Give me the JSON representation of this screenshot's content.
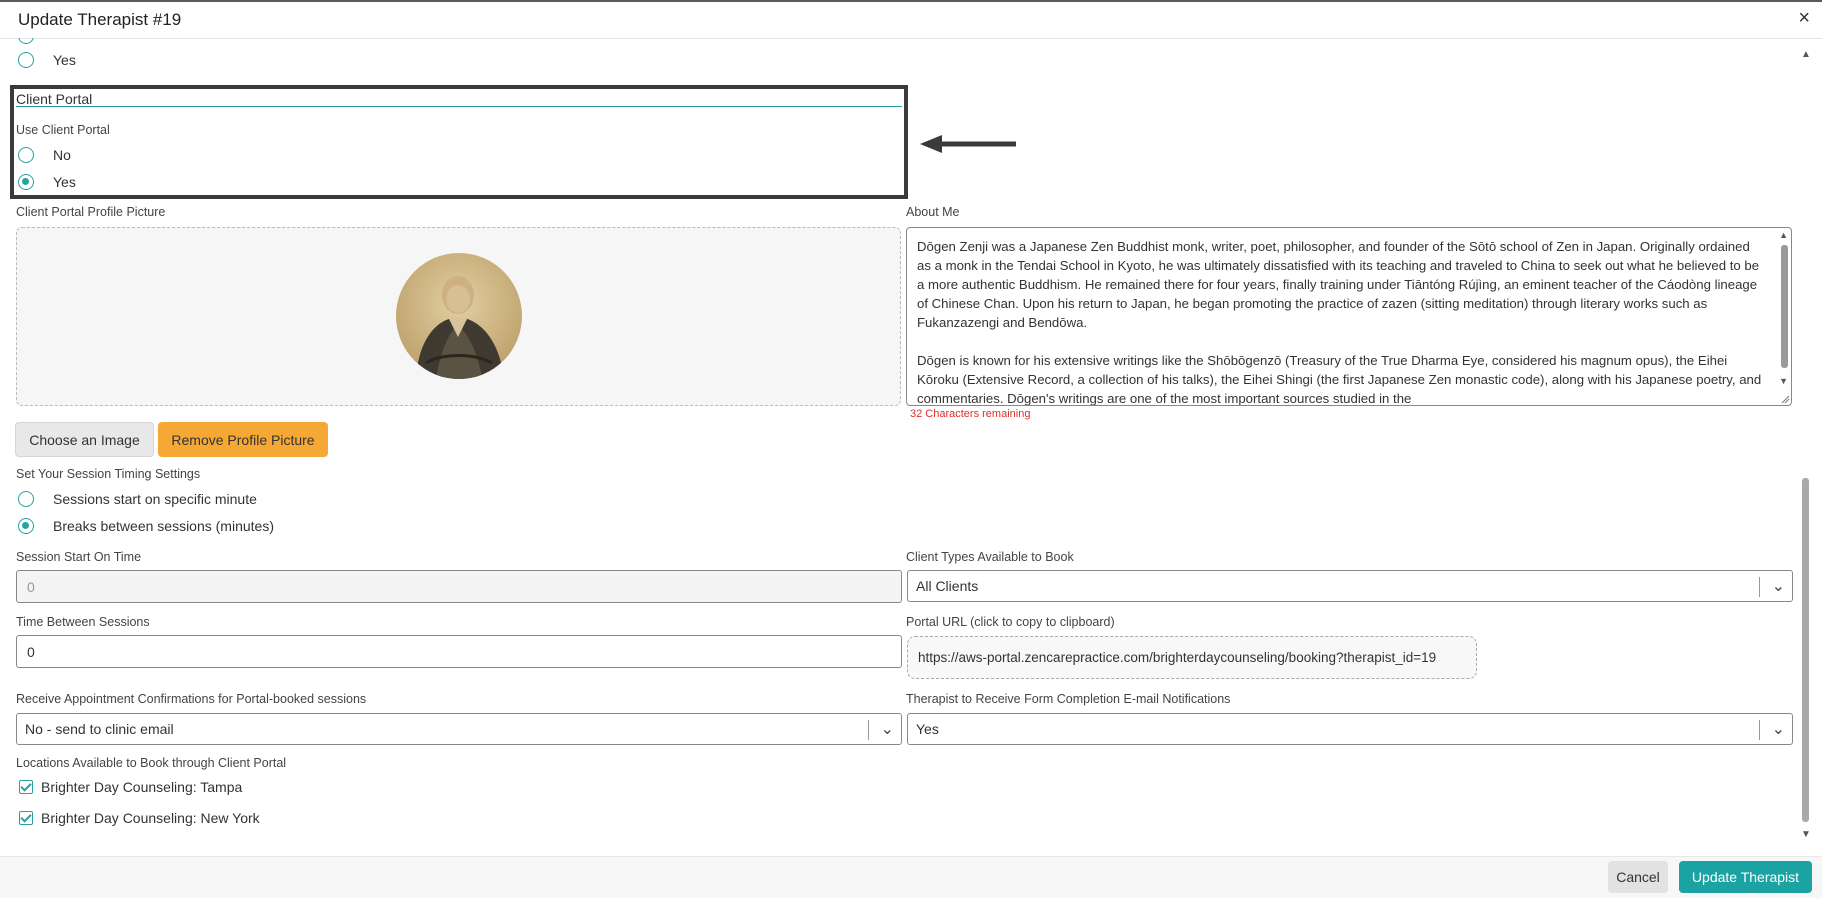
{
  "header": {
    "title": "Update Therapist #19",
    "close_glyph": "×"
  },
  "prev_question": {
    "yes_label": "Yes"
  },
  "client_portal": {
    "section_title": "Client Portal",
    "use_label": "Use Client Portal",
    "options": [
      "No",
      "Yes"
    ],
    "selected": "Yes"
  },
  "profile_picture": {
    "label": "Client Portal Profile Picture",
    "choose_button": "Choose an Image",
    "remove_button": "Remove Profile Picture"
  },
  "about_me": {
    "label": "About Me",
    "text": "Dōgen Zenji was a Japanese Zen Buddhist monk, writer, poet, philosopher, and founder of the Sōtō school of Zen in Japan. Originally ordained as a monk in the Tendai School in Kyoto, he was ultimately dissatisfied with its teaching and traveled to China to seek out what he believed to be a more authentic Buddhism. He remained there for four years, finally training under Tiāntóng Rújìng, an eminent teacher of the Cáodòng lineage of Chinese Chan. Upon his return to Japan, he began promoting the practice of zazen (sitting meditation) through literary works such as Fukanzazengi and Bendōwa.\n\nDōgen is known for his extensive writings like the Shōbōgenzō (Treasury of the True Dharma Eye, considered his magnum opus), the Eihei Kōroku (Extensive Record, a collection of his talks), the Eihei Shingi (the first Japanese Zen monastic code), along with his Japanese poetry, and commentaries. Dōgen's writings are one of the most important sources studied in the",
    "chars_remaining": "32 Characters remaining"
  },
  "session_timing": {
    "label": "Set Your Session Timing Settings",
    "options": [
      "Sessions start on specific minute",
      "Breaks between sessions (minutes)"
    ],
    "selected": "Breaks between sessions (minutes)"
  },
  "session_start": {
    "label": "Session Start On Time",
    "placeholder": "0"
  },
  "time_between": {
    "label": "Time Between Sessions",
    "value": "0"
  },
  "client_types": {
    "label": "Client Types Available to Book",
    "value": "All Clients"
  },
  "portal_url": {
    "label": "Portal URL (click to copy to clipboard)",
    "value": "https://aws-portal.zencarepractice.com/brighterdaycounseling/booking?therapist_id=19"
  },
  "confirmations": {
    "label": "Receive Appointment Confirmations for Portal-booked sessions",
    "value": "No - send to clinic email"
  },
  "form_notifications": {
    "label": "Therapist to Receive Form Completion E-mail Notifications",
    "value": "Yes"
  },
  "locations": {
    "label": "Locations Available to Book through Client Portal",
    "items": [
      "Brighter Day Counseling: Tampa",
      "Brighter Day Counseling: New York"
    ]
  },
  "footer": {
    "cancel": "Cancel",
    "update": "Update Therapist"
  },
  "colors": {
    "accent": "#1ba2a2",
    "orange": "#f5a833",
    "error": "#d9322b"
  }
}
